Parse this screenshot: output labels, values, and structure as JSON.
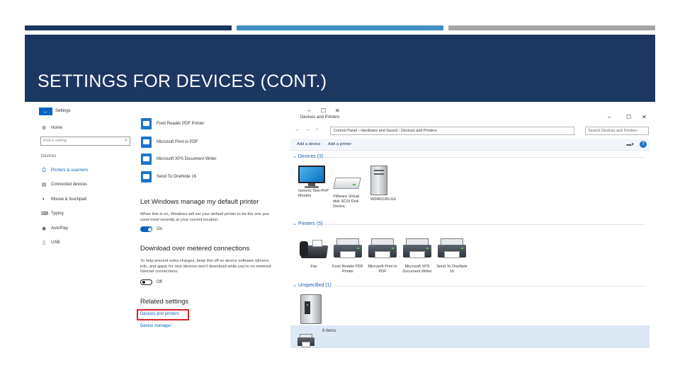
{
  "slide": {
    "title": "SETTINGS FOR DEVICES (CONT.)",
    "colors": {
      "navy": "#1c3762",
      "blue": "#3f8fc0",
      "gray": "#a6a6a6"
    }
  },
  "settings": {
    "back_glyph": "←",
    "title": "Settings",
    "home_label": "Home",
    "search_placeholder": "Find a setting",
    "section_label": "Devices",
    "nav": [
      {
        "label": "Printers & scanners",
        "icon": "printer-icon"
      },
      {
        "label": "Connected devices",
        "icon": "devices-icon"
      },
      {
        "label": "Mouse & touchpad",
        "icon": "mouse-icon"
      },
      {
        "label": "Typing",
        "icon": "keyboard-icon"
      },
      {
        "label": "AutoPlay",
        "icon": "autoplay-icon"
      },
      {
        "label": "USB",
        "icon": "usb-icon"
      }
    ],
    "printers": [
      {
        "label": "Foxit Reader PDF Printer"
      },
      {
        "label": "Microsoft Print to PDF"
      },
      {
        "label": "Microsoft XPS Document Writer"
      },
      {
        "label": "Send To OneNote 16"
      }
    ],
    "default_printer": {
      "heading": "Let Windows manage my default printer",
      "description": "When this is on, Windows will set your default printer to be the one you used most recently at your current location.",
      "toggle_label": "On"
    },
    "metered": {
      "heading": "Download over metered connections",
      "description": "To help prevent extra charges, keep this off so device software (drivers, info, and apps) for new devices won't download while you're on metered Internet connections.",
      "toggle_label": "Off"
    },
    "related": {
      "heading": "Related settings",
      "links": [
        "Devices and printers",
        "Device manager"
      ]
    }
  },
  "window": {
    "title": "Devices and Printers",
    "controls": {
      "minimize": "–",
      "maximize": "☐",
      "close": "✕"
    },
    "outer_controls": {
      "minimize": "–",
      "maximize": "☐",
      "close": "✕"
    },
    "address": "Control Panel  ›  Hardware and Sound  ›  Devices and Printers",
    "search_placeholder": "Search Devices and Printers",
    "commands": {
      "add_device": "Add a device",
      "add_printer": "Add a printer"
    },
    "groups": {
      "devices": "Devices (3)",
      "printers": "Printers (5)",
      "unspecified": "Unspecified (1)"
    },
    "devices": [
      {
        "label": "Generic Non-PnP Monitor",
        "icon": "monitor-icon"
      },
      {
        "label": "VMware Virtual disk SCSI Disk Device",
        "icon": "disk-drive-icon"
      },
      {
        "label": "W0460180-G6",
        "icon": "computer-tower-icon"
      }
    ],
    "printers": [
      {
        "label": "Fax",
        "icon": "fax-icon"
      },
      {
        "label": "Foxit Reader PDF Printer",
        "icon": "printer-icon"
      },
      {
        "label": "Microsoft Print to PDF",
        "icon": "printer-icon"
      },
      {
        "label": "Microsoft XPS Document Writer",
        "icon": "printer-icon"
      },
      {
        "label": "Send To OneNote 16",
        "icon": "printer-icon"
      }
    ],
    "status": "9 items"
  }
}
